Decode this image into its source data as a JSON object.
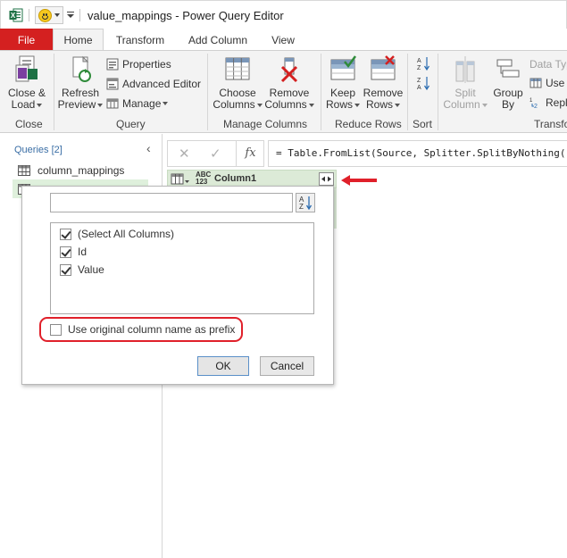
{
  "window": {
    "title": "value_mappings - Power Query Editor",
    "app_icon": "excel-icon",
    "quick_access_icon": "smiley-icon"
  },
  "tabs": [
    {
      "label": "File"
    },
    {
      "label": "Home"
    },
    {
      "label": "Transform"
    },
    {
      "label": "Add Column"
    },
    {
      "label": "View"
    }
  ],
  "ribbon": {
    "close_group": {
      "label": "Close",
      "close_load": {
        "line1": "Close &",
        "line2": "Load"
      }
    },
    "query_group": {
      "label": "Query",
      "refresh": {
        "line1": "Refresh",
        "line2": "Preview"
      },
      "properties": "Properties",
      "advanced_editor": "Advanced Editor",
      "manage": "Manage"
    },
    "manage_columns_group": {
      "label": "Manage Columns",
      "choose": {
        "line1": "Choose",
        "line2": "Columns"
      },
      "remove": {
        "line1": "Remove",
        "line2": "Columns"
      }
    },
    "reduce_rows_group": {
      "label": "Reduce Rows",
      "keep": {
        "line1": "Keep",
        "line2": "Rows"
      },
      "remove": {
        "line1": "Remove",
        "line2": "Rows"
      }
    },
    "sort_group": {
      "label": "Sort"
    },
    "transform_group": {
      "label": "Transfo",
      "split": {
        "line1": "Split",
        "line2": "Column"
      },
      "group": {
        "line1": "Group",
        "line2": "By"
      },
      "data_type": "Data Typ",
      "use": "Use",
      "replace": "Repl"
    }
  },
  "queries": {
    "header": "Queries [2]",
    "collapse_glyph": "‹",
    "items": [
      {
        "label": "column_mappings",
        "selected": false
      }
    ]
  },
  "formula_bar": {
    "cancel_glyph": "✕",
    "confirm_glyph": "✓",
    "fx_glyph": "fx",
    "formula": "= Table.FromList(Source, Splitter.SplitByNothing("
  },
  "grid": {
    "column_header": {
      "type_top": "ABC",
      "type_bottom": "123",
      "name": "Column1"
    }
  },
  "popup": {
    "search_value": "",
    "columns": [
      {
        "label": "(Select All Columns)",
        "checked": true
      },
      {
        "label": "Id",
        "checked": true
      },
      {
        "label": "Value",
        "checked": true
      }
    ],
    "prefix_option": {
      "label": "Use original column name as prefix",
      "checked": false
    },
    "ok_label": "OK",
    "cancel_label": "Cancel"
  },
  "colors": {
    "file_tab": "#d42020",
    "highlight": "#e0202a",
    "header_green": "#dcead7",
    "selected_query": "#dff0dc"
  }
}
